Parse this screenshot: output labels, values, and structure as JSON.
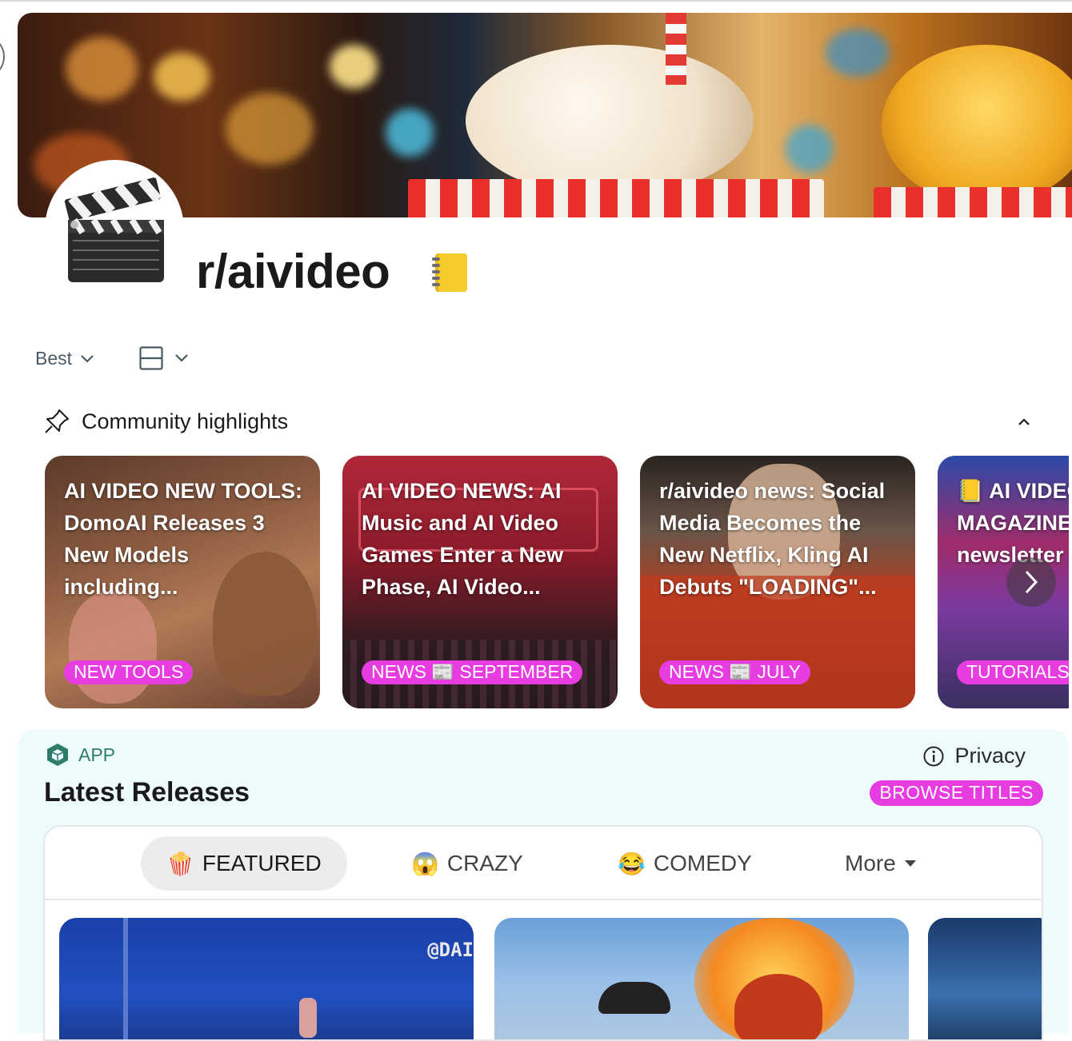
{
  "subreddit": {
    "name": "r/aivideo",
    "title_emoji": "notebook-emoji"
  },
  "sort": {
    "label": "Best"
  },
  "highlights": {
    "heading": "Community highlights",
    "cards": [
      {
        "title": "AI VIDEO NEW TOOLS: DomoAI Releases 3 New Models including...",
        "tag": "NEW TOOLS"
      },
      {
        "title": "AI VIDEO NEWS: AI Music and AI Video Games Enter a New Phase, AI Video...",
        "tag": "NEWS 📰 SEPTEMBER"
      },
      {
        "title": "r/aivideo news: Social Media Becomes the New Netflix, Kling AI Debuts \"LOADING\"...",
        "tag": "NEWS 📰 JULY"
      },
      {
        "title": "📒 AI VIDEO MAGAZINE community newsletter",
        "tag": "TUTORIALS"
      }
    ]
  },
  "app": {
    "label": "APP",
    "privacy": "Privacy",
    "heading": "Latest Releases",
    "browse": "BROWSE TITLES",
    "tabs": [
      {
        "emoji": "🍿",
        "label": "FEATURED"
      },
      {
        "emoji": "😱",
        "label": "CRAZY"
      },
      {
        "emoji": "😂",
        "label": "COMEDY"
      }
    ],
    "more": "More",
    "watermark": "@DAI"
  },
  "colors": {
    "tag_pink": "#e63ce0",
    "app_bg": "#eefbfd",
    "app_green": "#2d7d6a"
  }
}
